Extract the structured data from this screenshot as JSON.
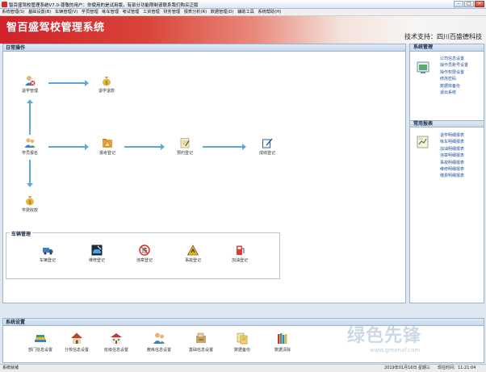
{
  "window": {
    "title": "智百盛驾校管理系统V7.0-尊敬的用户：你使用的是试用版，有部分功能限制请联系我们购买正版",
    "controls": [
      "minimize",
      "maximize",
      "close"
    ]
  },
  "menu": [
    "系统管理(S)",
    "基础设置(B)",
    "车辆管理(V)",
    "学员管理",
    "练车管理",
    "考试管理",
    "工资管理",
    "财务管理",
    "报表分析(R)",
    "数据管理(D)",
    "辅助工具",
    "系统帮助(H)"
  ],
  "banner": {
    "brand": "智百盛驾校管理系统",
    "support": "技术支持：四川百盛德科技"
  },
  "daily": {
    "header": "日常操作",
    "nodes": {
      "dropout": {
        "label": "退学管理",
        "icon": "user-remove-icon"
      },
      "refund": {
        "label": "退学退款",
        "icon": "money-bag-icon"
      },
      "enroll": {
        "label": "学员报名",
        "icon": "users-icon"
      },
      "report": {
        "label": "报考登记",
        "icon": "warning-folder-icon"
      },
      "prepare": {
        "label": "预约登记",
        "icon": "notepad-icon"
      },
      "score": {
        "label": "成绩登记",
        "icon": "edit-icon"
      },
      "fee": {
        "label": "学费收款",
        "icon": "money-bag-icon"
      }
    }
  },
  "vehicle": {
    "header": "车辆管理",
    "items": [
      {
        "label": "车辆登记",
        "icon": "truck-icon"
      },
      {
        "label": "维修登记",
        "icon": "car-repair-icon"
      },
      {
        "label": "违章登记",
        "icon": "violation-icon"
      },
      {
        "label": "事故登记",
        "icon": "accident-warning-icon"
      },
      {
        "label": "加油登记",
        "icon": "fuel-pump-icon"
      }
    ]
  },
  "sys_panel": {
    "header": "系统管理",
    "links": [
      "公司信息设置",
      "操作员账号设置",
      "操作权限设置",
      "修改密码",
      "数据库备份",
      "退出系统"
    ]
  },
  "report_panel": {
    "header": "常用报表",
    "links": [
      "退学明细报表",
      "练车明细报表",
      "加油明细报表",
      "违章明细报表",
      "事故明细报表",
      "维修明细报表",
      "缴费明细报表"
    ]
  },
  "settings": {
    "header": "系统设置",
    "items": [
      {
        "label": "部门信息设置",
        "icon": "books-icon"
      },
      {
        "label": "分校信息设置",
        "icon": "house-icon"
      },
      {
        "label": "班级信息设置",
        "icon": "building-icon"
      },
      {
        "label": "教练信息设置",
        "icon": "coach-icon"
      },
      {
        "label": "基础信息设置",
        "icon": "settings-box-icon"
      },
      {
        "label": "数据备份",
        "icon": "database-backup-icon"
      },
      {
        "label": "数据清除",
        "icon": "data-clear-icon"
      }
    ]
  },
  "status": {
    "left": "系统就绪",
    "date": "2019年01月16日 星期三",
    "time": "现在时间：11:21:04"
  },
  "watermark": {
    "main": "绿色先锋",
    "sub": "www.greenxf.com"
  }
}
